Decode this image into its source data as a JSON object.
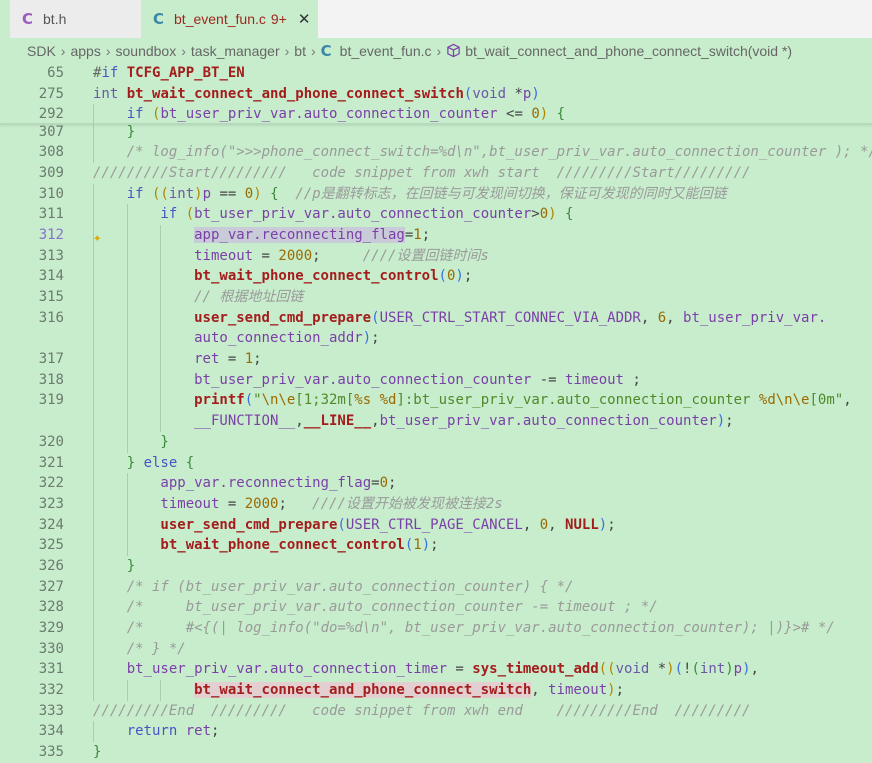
{
  "tabs": [
    {
      "label": "bt.h",
      "icon": "c-file-icon",
      "active": false
    },
    {
      "label": "bt_event_fun.c",
      "badge": "9+",
      "icon": "c-file-icon",
      "active": true
    }
  ],
  "breadcrumb": [
    "SDK",
    "apps",
    "soundbox",
    "task_manager",
    "bt",
    "bt_event_fun.c",
    "bt_wait_connect_and_phone_connect_switch(void *)"
  ],
  "colors": {
    "editor_bg": "#c7edcc",
    "function": "#a31d1d",
    "keyword": "#4a52c4",
    "variable": "#7b3fa8",
    "comment": "#9a9a9a",
    "string": "#4f8a2a"
  },
  "current_line": "312",
  "sticky": [
    {
      "n": "65",
      "t": [
        [
          "hash",
          "#"
        ],
        [
          "kw",
          "if"
        ],
        [
          "pl",
          " "
        ],
        [
          "fn",
          "TCFG_APP_BT_EN"
        ]
      ]
    },
    {
      "n": "275",
      "t": [
        [
          "ty",
          "int"
        ],
        [
          "pl",
          " "
        ],
        [
          "fn",
          "bt_wait_connect_and_phone_connect_switch"
        ],
        [
          "p2",
          "("
        ],
        [
          "ty",
          "void"
        ],
        [
          "pl",
          " *"
        ],
        [
          "var",
          "p"
        ],
        [
          "p2",
          ")"
        ]
      ]
    },
    {
      "n": "292",
      "t": [
        [
          "ws",
          "    "
        ],
        [
          "kw",
          "if"
        ],
        [
          "pl",
          " "
        ],
        [
          "p1",
          "("
        ],
        [
          "var",
          "bt_user_priv_var.auto_connection_counter"
        ],
        [
          "pl",
          " <= "
        ],
        [
          "num",
          "0"
        ],
        [
          "p1",
          ")"
        ],
        [
          "pl",
          " "
        ],
        [
          "p3",
          "{"
        ]
      ]
    }
  ],
  "lines": [
    {
      "n": "307",
      "t": [
        [
          "ws",
          "    "
        ],
        [
          "p3",
          "}"
        ]
      ]
    },
    {
      "n": "308",
      "t": [
        [
          "ws",
          "    "
        ],
        [
          "cmt",
          "/* log_info(\">>>phone_connect_switch=%d\\n\",bt_user_priv_var.auto_connection_counter ); */"
        ]
      ]
    },
    {
      "n": "309",
      "t": [
        [
          "cmt",
          "/////////Start/////////   code snippet from xwh start  /////////Start/////////"
        ]
      ]
    },
    {
      "n": "310",
      "t": [
        [
          "ws",
          "    "
        ],
        [
          "kw",
          "if"
        ],
        [
          "pl",
          " "
        ],
        [
          "p1",
          "(("
        ],
        [
          "ty",
          "int"
        ],
        [
          "p1",
          ")"
        ],
        [
          "var",
          "p"
        ],
        [
          "pl",
          " == "
        ],
        [
          "num",
          "0"
        ],
        [
          "p1",
          ")"
        ],
        [
          "pl",
          " "
        ],
        [
          "p3",
          "{"
        ],
        [
          "pl",
          "  "
        ],
        [
          "cmt",
          "//p是翻转标志，在回链与可发现间切换，保证可发现的同时又能回链"
        ]
      ]
    },
    {
      "n": "311",
      "t": [
        [
          "ws",
          "        "
        ],
        [
          "kw",
          "if"
        ],
        [
          "pl",
          " "
        ],
        [
          "p1",
          "("
        ],
        [
          "var",
          "bt_user_priv_var.auto_connection_counter"
        ],
        [
          "pl",
          ">"
        ],
        [
          "num",
          "0"
        ],
        [
          "p1",
          ")"
        ],
        [
          "pl",
          " "
        ],
        [
          "p3",
          "{"
        ]
      ]
    },
    {
      "n": "312",
      "t": [
        [
          "ws",
          "            "
        ],
        [
          "var sel",
          "app_var.reconnecting_flag"
        ],
        [
          "pl",
          "="
        ],
        [
          "num",
          "1"
        ],
        [
          "pl",
          ";"
        ]
      ]
    },
    {
      "n": "313",
      "t": [
        [
          "ws",
          "            "
        ],
        [
          "var",
          "timeout"
        ],
        [
          "pl",
          " = "
        ],
        [
          "num",
          "2000"
        ],
        [
          "pl",
          ";     "
        ],
        [
          "cmt",
          "////设置回链时间s"
        ]
      ]
    },
    {
      "n": "314",
      "t": [
        [
          "ws",
          "            "
        ],
        [
          "fn",
          "bt_wait_phone_connect_control"
        ],
        [
          "p2",
          "("
        ],
        [
          "num",
          "0"
        ],
        [
          "p2",
          ")"
        ],
        [
          "pl",
          ";"
        ]
      ]
    },
    {
      "n": "315",
      "t": [
        [
          "ws",
          "            "
        ],
        [
          "cmt",
          "// 根据地址回链"
        ]
      ]
    },
    {
      "n": "316",
      "t": [
        [
          "ws",
          "            "
        ],
        [
          "fn",
          "user_send_cmd_prepare"
        ],
        [
          "p2",
          "("
        ],
        [
          "var",
          "USER_CTRL_START_CONNEC_VIA_ADDR"
        ],
        [
          "pl",
          ", "
        ],
        [
          "num",
          "6"
        ],
        [
          "pl",
          ", "
        ],
        [
          "var",
          "bt_user_priv_var."
        ]
      ]
    },
    {
      "n": "",
      "t": [
        [
          "ws",
          "            "
        ],
        [
          "var",
          "auto_connection_addr"
        ],
        [
          "p2",
          ")"
        ],
        [
          "pl",
          ";"
        ]
      ]
    },
    {
      "n": "317",
      "t": [
        [
          "ws",
          "            "
        ],
        [
          "var",
          "ret"
        ],
        [
          "pl",
          " = "
        ],
        [
          "num",
          "1"
        ],
        [
          "pl",
          ";"
        ]
      ]
    },
    {
      "n": "318",
      "t": [
        [
          "ws",
          "            "
        ],
        [
          "var",
          "bt_user_priv_var.auto_connection_counter"
        ],
        [
          "pl",
          " -= "
        ],
        [
          "var",
          "timeout"
        ],
        [
          "pl",
          " ;"
        ]
      ]
    },
    {
      "n": "319",
      "t": [
        [
          "ws",
          "            "
        ],
        [
          "fn",
          "printf"
        ],
        [
          "p2",
          "("
        ],
        [
          "str",
          "\""
        ],
        [
          "esc",
          "\\n\\e"
        ],
        [
          "str",
          "[1;32m["
        ],
        [
          "esc",
          "%s %d"
        ],
        [
          "str",
          "]:bt_user_priv_var.auto_connection_counter "
        ],
        [
          "esc",
          "%d\\n\\e"
        ],
        [
          "str",
          "[0m\""
        ],
        [
          "pl",
          ","
        ]
      ]
    },
    {
      "n": "",
      "t": [
        [
          "ws",
          "            "
        ],
        [
          "var",
          "__FUNCTION__"
        ],
        [
          "pl",
          ","
        ],
        [
          "fn",
          "__LINE__"
        ],
        [
          "pl",
          ","
        ],
        [
          "var",
          "bt_user_priv_var.auto_connection_counter"
        ],
        [
          "p2",
          ")"
        ],
        [
          "pl",
          ";"
        ]
      ]
    },
    {
      "n": "320",
      "t": [
        [
          "ws",
          "        "
        ],
        [
          "p3",
          "}"
        ]
      ]
    },
    {
      "n": "321",
      "t": [
        [
          "ws",
          "    "
        ],
        [
          "p3",
          "}"
        ],
        [
          "pl",
          " "
        ],
        [
          "kw",
          "else"
        ],
        [
          "pl",
          " "
        ],
        [
          "p3",
          "{"
        ]
      ]
    },
    {
      "n": "322",
      "t": [
        [
          "ws",
          "        "
        ],
        [
          "var",
          "app_var.reconnecting_flag"
        ],
        [
          "pl",
          "="
        ],
        [
          "num",
          "0"
        ],
        [
          "pl",
          ";"
        ]
      ]
    },
    {
      "n": "323",
      "t": [
        [
          "ws",
          "        "
        ],
        [
          "var",
          "timeout"
        ],
        [
          "pl",
          " = "
        ],
        [
          "num",
          "2000"
        ],
        [
          "pl",
          ";   "
        ],
        [
          "cmt",
          "////设置开始被发现被连接2s"
        ]
      ]
    },
    {
      "n": "324",
      "t": [
        [
          "ws",
          "        "
        ],
        [
          "fn",
          "user_send_cmd_prepare"
        ],
        [
          "p2",
          "("
        ],
        [
          "var",
          "USER_CTRL_PAGE_CANCEL"
        ],
        [
          "pl",
          ", "
        ],
        [
          "num",
          "0"
        ],
        [
          "pl",
          ", "
        ],
        [
          "fn",
          "NULL"
        ],
        [
          "p2",
          ")"
        ],
        [
          "pl",
          ";"
        ]
      ]
    },
    {
      "n": "325",
      "t": [
        [
          "ws",
          "        "
        ],
        [
          "fn",
          "bt_wait_phone_connect_control"
        ],
        [
          "p2",
          "("
        ],
        [
          "num",
          "1"
        ],
        [
          "p2",
          ")"
        ],
        [
          "pl",
          ";"
        ]
      ]
    },
    {
      "n": "326",
      "t": [
        [
          "ws",
          "    "
        ],
        [
          "p3",
          "}"
        ]
      ]
    },
    {
      "n": "327",
      "t": [
        [
          "ws",
          "    "
        ],
        [
          "cmt",
          "/* if (bt_user_priv_var.auto_connection_counter) { */"
        ]
      ]
    },
    {
      "n": "328",
      "t": [
        [
          "ws",
          "    "
        ],
        [
          "cmt",
          "/*     bt_user_priv_var.auto_connection_counter -= timeout ; */"
        ]
      ]
    },
    {
      "n": "329",
      "t": [
        [
          "ws",
          "    "
        ],
        [
          "cmt",
          "/*     #<{(| log_info(\"do=%d\\n\", bt_user_priv_var.auto_connection_counter); |)}># */"
        ]
      ]
    },
    {
      "n": "330",
      "t": [
        [
          "ws",
          "    "
        ],
        [
          "cmt",
          "/* } */"
        ]
      ]
    },
    {
      "n": "331",
      "t": [
        [
          "ws",
          "    "
        ],
        [
          "var",
          "bt_user_priv_var.auto_connection_timer"
        ],
        [
          "pl",
          " = "
        ],
        [
          "fn",
          "sys_timeout_add"
        ],
        [
          "p1",
          "(("
        ],
        [
          "ty",
          "void"
        ],
        [
          "pl",
          " *"
        ],
        [
          "p1",
          ")"
        ],
        [
          "p2",
          "("
        ],
        [
          "pl",
          "!"
        ],
        [
          "p3",
          "("
        ],
        [
          "ty",
          "int"
        ],
        [
          "p3",
          ")"
        ],
        [
          "var",
          "p"
        ],
        [
          "p2",
          ")"
        ],
        [
          "pl",
          ","
        ]
      ]
    },
    {
      "n": "332",
      "t": [
        [
          "ws",
          "            "
        ],
        [
          "fn hl",
          "bt_wait_connect_and_phone_connect_switch"
        ],
        [
          "pl",
          ", "
        ],
        [
          "var",
          "timeout"
        ],
        [
          "p1",
          ")"
        ],
        [
          "pl",
          ";"
        ]
      ]
    },
    {
      "n": "333",
      "t": [
        [
          "cmt",
          "/////////End  /////////   code snippet from xwh end    /////////End  /////////"
        ]
      ]
    },
    {
      "n": "334",
      "t": [
        [
          "ws",
          "    "
        ],
        [
          "kw",
          "return"
        ],
        [
          "pl",
          " "
        ],
        [
          "var",
          "ret"
        ],
        [
          "pl",
          ";"
        ]
      ]
    },
    {
      "n": "335",
      "t": [
        [
          "p3",
          "}"
        ]
      ]
    }
  ]
}
